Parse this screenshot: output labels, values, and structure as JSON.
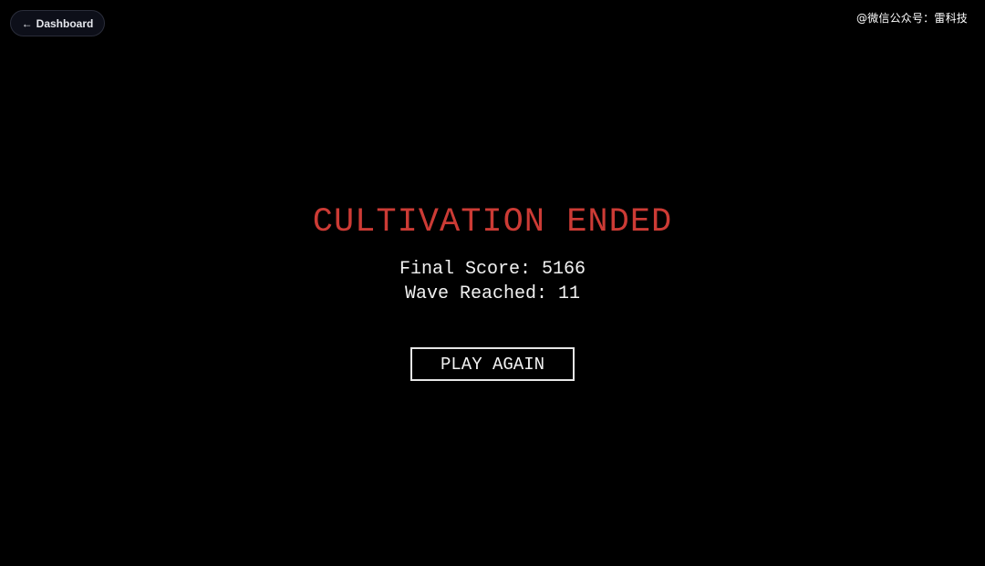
{
  "nav": {
    "back_label": "Dashboard",
    "back_icon": "arrow-left-icon"
  },
  "watermark": "@微信公众号：雷科技",
  "game_over": {
    "title": "CULTIVATION ENDED",
    "final_score_label": "Final Score:",
    "final_score": "5166",
    "wave_label": "Wave Reached:",
    "wave": "11",
    "play_again_label": "PLAY AGAIN"
  },
  "colors": {
    "background": "#000000",
    "title": "#cc3b35",
    "text": "#f2f2f2",
    "button_border": "#e6e6e6"
  }
}
